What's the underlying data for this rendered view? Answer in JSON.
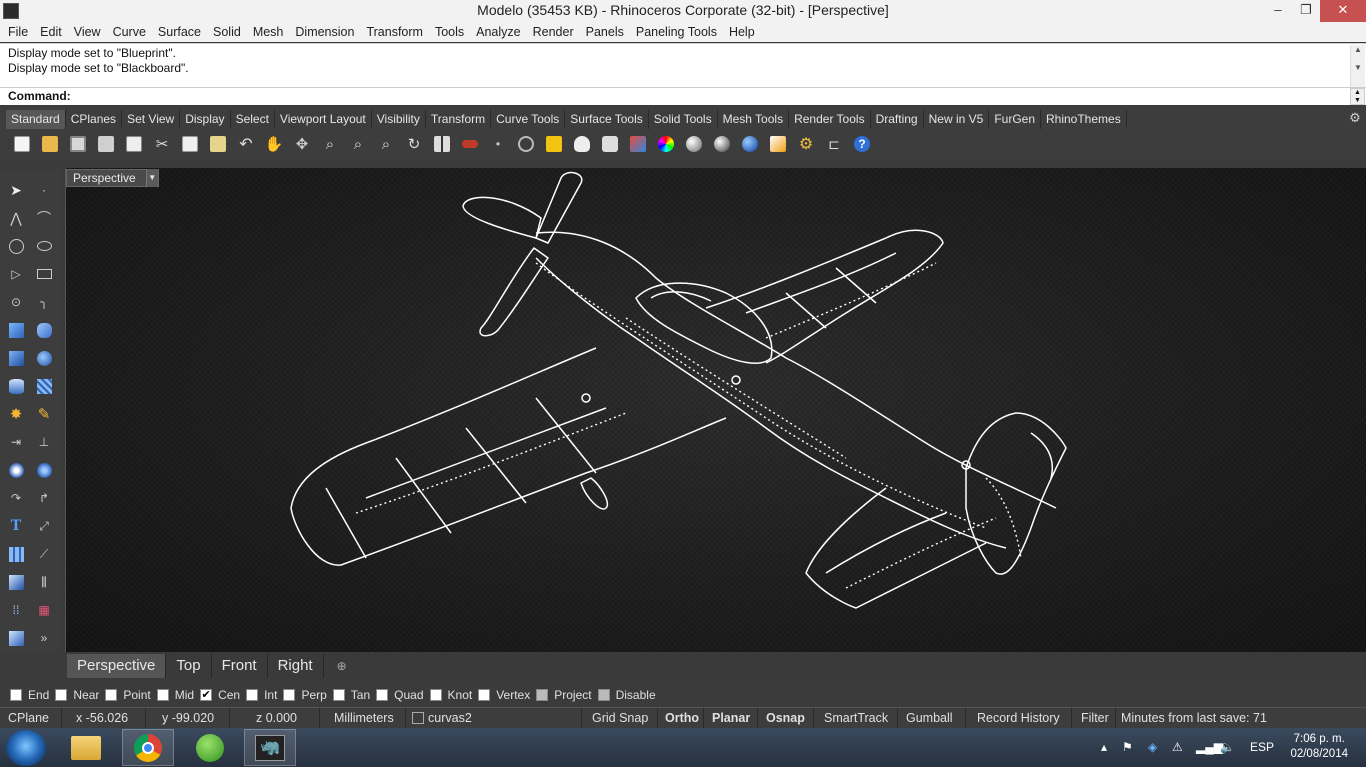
{
  "window": {
    "title": "Modelo (35453 KB) - Rhinoceros Corporate (32-bit) - [Perspective]",
    "minimize": "–",
    "maximize": "❐",
    "close": "✕"
  },
  "menu": [
    "File",
    "Edit",
    "View",
    "Curve",
    "Surface",
    "Solid",
    "Mesh",
    "Dimension",
    "Transform",
    "Tools",
    "Analyze",
    "Render",
    "Panels",
    "Paneling Tools",
    "Help"
  ],
  "history": [
    "Display mode set to \"Blueprint\".",
    "Display mode set to \"Blackboard\"."
  ],
  "command": {
    "label": "Command:"
  },
  "toolbar_tabs": [
    "Standard",
    "CPlanes",
    "Set View",
    "Display",
    "Select",
    "Viewport Layout",
    "Visibility",
    "Transform",
    "Curve Tools",
    "Surface Tools",
    "Solid Tools",
    "Mesh Tools",
    "Render Tools",
    "Drafting",
    "New in V5",
    "FurGen",
    "RhinoThemes"
  ],
  "toolbar_icons": [
    "new-icon",
    "open-icon",
    "save-icon",
    "print-icon",
    "import-icon",
    "cut-icon",
    "copy-icon",
    "paste-icon",
    "undo-icon",
    "pan-icon",
    "rotate-view-icon",
    "zoom-icon",
    "zoom-extents-icon",
    "zoom-window-icon",
    "rotate-icon",
    "four-viewports-icon",
    "car-icon",
    "point-icon",
    "circle-icon",
    "selection-icon",
    "light-icon",
    "lock-icon",
    "material-icon",
    "color-wheel-icon",
    "shaded-sphere-icon",
    "rendered-sphere-icon",
    "blue-sphere-icon",
    "render-icon",
    "settings-gear-icon",
    "dimension-icon",
    "help-icon"
  ],
  "viewport": {
    "name": "Perspective"
  },
  "viewport_tabs": [
    "Perspective",
    "Top",
    "Front",
    "Right"
  ],
  "osnap": [
    {
      "label": "End",
      "checked": false
    },
    {
      "label": "Near",
      "checked": false
    },
    {
      "label": "Point",
      "checked": false
    },
    {
      "label": "Mid",
      "checked": false
    },
    {
      "label": "Cen",
      "checked": true
    },
    {
      "label": "Int",
      "checked": false
    },
    {
      "label": "Perp",
      "checked": false
    },
    {
      "label": "Tan",
      "checked": false
    },
    {
      "label": "Quad",
      "checked": false
    },
    {
      "label": "Knot",
      "checked": false
    },
    {
      "label": "Vertex",
      "checked": false
    },
    {
      "label": "Project",
      "checked": false
    },
    {
      "label": "Disable",
      "checked": false
    }
  ],
  "status": {
    "cplane": "CPlane",
    "x": "x -56.026",
    "y": "y -99.020",
    "z": "z 0.000",
    "units": "Millimeters",
    "layer": "curvas2",
    "grid_snap": "Grid Snap",
    "ortho": "Ortho",
    "planar": "Planar",
    "osnap": "Osnap",
    "smarttrack": "SmartTrack",
    "gumball": "Gumball",
    "record_history": "Record History",
    "filter": "Filter",
    "save_info": "Minutes from last save: 71"
  },
  "taskbar": {
    "language": "ESP",
    "time": "7:06 p. m.",
    "date": "02/08/2014"
  },
  "colors": {
    "accent": "#1e88e5",
    "background": "#3b3b3b",
    "viewport": "#1f1f1f",
    "wire": "#ffffff"
  }
}
